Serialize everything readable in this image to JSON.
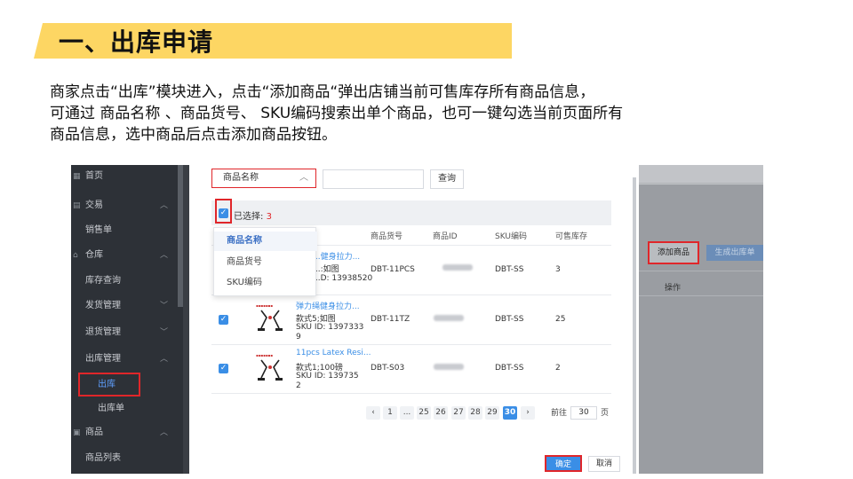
{
  "slide": {
    "title": "一、出库申请",
    "description_lines": [
      "商家点击“出库”模块进入，点击“添加商品“弹出店铺当前可售库存所有商品信息，",
      "可通过 商品名称 、商品货号、 SKU编码搜索出单个商品，也可一键勾选当前页面所有",
      "商品信息，选中商品后点击添加商品按钮。"
    ]
  },
  "sidebar": {
    "items": [
      {
        "label": "首页",
        "icon": "grid-icon",
        "chevron": ""
      },
      {
        "label": "交易",
        "icon": "doc-icon",
        "chevron": "^"
      },
      {
        "label": "销售单",
        "icon": "",
        "chevron": ""
      },
      {
        "label": "仓库",
        "icon": "lock-icon",
        "chevron": "^"
      },
      {
        "label": "库存查询",
        "icon": "",
        "chevron": ""
      },
      {
        "label": "发货管理",
        "icon": "",
        "chevron": "v"
      },
      {
        "label": "退货管理",
        "icon": "",
        "chevron": "v"
      },
      {
        "label": "出库管理",
        "icon": "",
        "chevron": "^"
      },
      {
        "label": "出库",
        "icon": "",
        "chevron": ""
      },
      {
        "label": "出库单",
        "icon": "",
        "chevron": ""
      },
      {
        "label": "商品",
        "icon": "box-icon",
        "chevron": "^"
      },
      {
        "label": "商品列表",
        "icon": "",
        "chevron": ""
      }
    ]
  },
  "dialog": {
    "search_field": "商品名称",
    "query_button": "查询",
    "selected_label": "已选择:",
    "selected_count": "3",
    "columns": [
      "商品货号",
      "商品ID",
      "SKU编码",
      "可售库存"
    ],
    "dropdown_options": [
      "商品名称",
      "商品货号",
      "SKU编码"
    ],
    "rows": [
      {
        "name": "...健身拉力...",
        "spec": "...:如图",
        "sku": "...D: 13938520",
        "code": "DBT-11PCS",
        "sku_code": "DBT-SS",
        "stock": "3"
      },
      {
        "name": "弹力绳健身拉力...",
        "spec": "款式5;如图",
        "sku": "SKU ID: 1397333",
        "sku_tail": "9",
        "code": "DBT-11TZ",
        "sku_code": "DBT-SS",
        "stock": "25"
      },
      {
        "name": "11pcs Latex Resi...",
        "spec": "款式1;100磅",
        "sku": "SKU ID: 139735",
        "sku_tail": "2",
        "code": "DBT-S03",
        "sku_code": "DBT-SS",
        "stock": "2"
      }
    ],
    "pagination": {
      "pages": [
        "1",
        "...",
        "25",
        "26",
        "27",
        "28",
        "29",
        "30"
      ],
      "current": "30",
      "goto_label": "前往",
      "goto_value": "30",
      "page_unit": "页"
    },
    "confirm_button": "确定",
    "cancel_button": "取消"
  },
  "right_panel": {
    "add_button": "添加商品",
    "generate_button": "生成出库单",
    "operation_label": "操作"
  },
  "colors": {
    "banner": "#fdd663",
    "highlight": "#e0262a",
    "primary": "#3a8ee6"
  }
}
